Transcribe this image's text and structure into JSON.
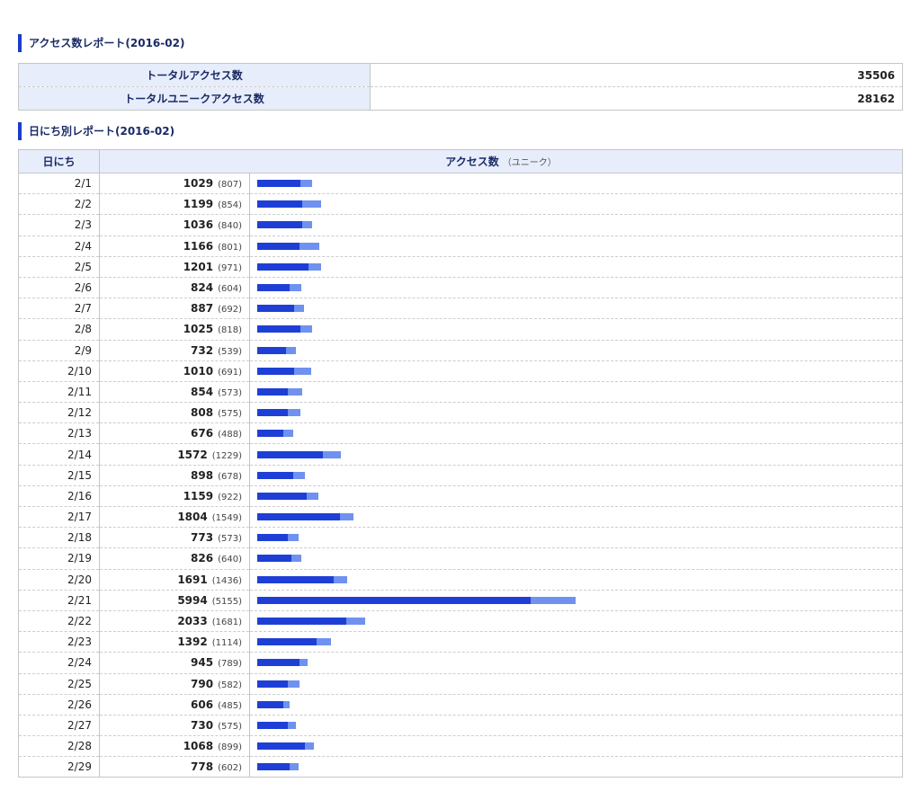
{
  "summary": {
    "title": "アクセス数レポート(2016-02)",
    "rows": [
      {
        "label": "トータルアクセス数",
        "value": "35506"
      },
      {
        "label": "トータルユニークアクセス数",
        "value": "28162"
      }
    ]
  },
  "daily": {
    "title": "日にち別レポート(2016-02)",
    "header_day": "日にち",
    "header_access": "アクセス数",
    "header_unique": "（ユニーク）",
    "colors": {
      "total_bar": "#6f91f0",
      "unique_bar": "#1e3fd6",
      "header_bg": "#e7edfa",
      "accent": "#1a3cc8"
    },
    "rows": [
      {
        "day": "2/1",
        "total": 1029,
        "unique": 807
      },
      {
        "day": "2/2",
        "total": 1199,
        "unique": 854
      },
      {
        "day": "2/3",
        "total": 1036,
        "unique": 840
      },
      {
        "day": "2/4",
        "total": 1166,
        "unique": 801
      },
      {
        "day": "2/5",
        "total": 1201,
        "unique": 971
      },
      {
        "day": "2/6",
        "total": 824,
        "unique": 604
      },
      {
        "day": "2/7",
        "total": 887,
        "unique": 692
      },
      {
        "day": "2/8",
        "total": 1025,
        "unique": 818
      },
      {
        "day": "2/9",
        "total": 732,
        "unique": 539
      },
      {
        "day": "2/10",
        "total": 1010,
        "unique": 691
      },
      {
        "day": "2/11",
        "total": 854,
        "unique": 573
      },
      {
        "day": "2/12",
        "total": 808,
        "unique": 575
      },
      {
        "day": "2/13",
        "total": 676,
        "unique": 488
      },
      {
        "day": "2/14",
        "total": 1572,
        "unique": 1229
      },
      {
        "day": "2/15",
        "total": 898,
        "unique": 678
      },
      {
        "day": "2/16",
        "total": 1159,
        "unique": 922
      },
      {
        "day": "2/17",
        "total": 1804,
        "unique": 1549
      },
      {
        "day": "2/18",
        "total": 773,
        "unique": 573
      },
      {
        "day": "2/19",
        "total": 826,
        "unique": 640
      },
      {
        "day": "2/20",
        "total": 1691,
        "unique": 1436
      },
      {
        "day": "2/21",
        "total": 5994,
        "unique": 5155
      },
      {
        "day": "2/22",
        "total": 2033,
        "unique": 1681
      },
      {
        "day": "2/23",
        "total": 1392,
        "unique": 1114
      },
      {
        "day": "2/24",
        "total": 945,
        "unique": 789
      },
      {
        "day": "2/25",
        "total": 790,
        "unique": 582
      },
      {
        "day": "2/26",
        "total": 606,
        "unique": 485
      },
      {
        "day": "2/27",
        "total": 730,
        "unique": 575
      },
      {
        "day": "2/28",
        "total": 1068,
        "unique": 899
      },
      {
        "day": "2/29",
        "total": 778,
        "unique": 602
      }
    ]
  }
}
